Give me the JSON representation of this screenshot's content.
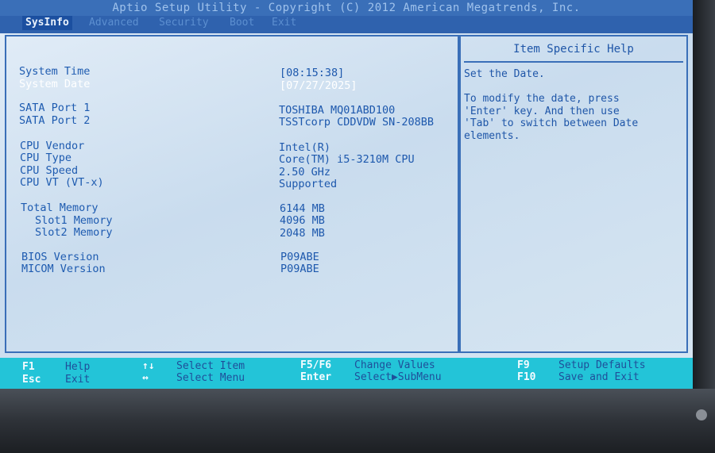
{
  "title": "Aptio Setup Utility - Copyright (C) 2012 American Megatrends, Inc.",
  "tabs": [
    {
      "label": "SysInfo",
      "active": true
    },
    {
      "label": "Advanced",
      "active": false
    },
    {
      "label": "Security",
      "active": false
    },
    {
      "label": "Boot",
      "active": false
    },
    {
      "label": "Exit",
      "active": false
    }
  ],
  "info": {
    "system_time": {
      "label": "System Time",
      "value": "[08:15:38]"
    },
    "system_date": {
      "label": "System Date",
      "value": "[07/27/2025]"
    },
    "sata1": {
      "label": "SATA Port 1",
      "value": "TOSHIBA MQ01ABD100"
    },
    "sata2": {
      "label": "SATA Port 2",
      "value": "TSSTcorp CDDVDW SN-208BB"
    },
    "cpu_vendor": {
      "label": "CPU Vendor",
      "value": "Intel(R)"
    },
    "cpu_type": {
      "label": "CPU Type",
      "value": "Core(TM) i5-3210M CPU"
    },
    "cpu_speed": {
      "label": "CPU Speed",
      "value": "2.50 GHz"
    },
    "cpu_vt": {
      "label": "CPU VT (VT-x)",
      "value": "Supported"
    },
    "total_memory": {
      "label": "Total Memory",
      "value": "6144 MB"
    },
    "slot1": {
      "label": "Slot1 Memory",
      "value": "4096 MB"
    },
    "slot2": {
      "label": "Slot2 Memory",
      "value": "2048 MB"
    },
    "bios_version": {
      "label": "BIOS Version",
      "value": "P09ABE"
    },
    "micom_version": {
      "label": "MICOM Version",
      "value": "P09ABE"
    }
  },
  "help": {
    "title": "Item Specific Help",
    "line1": "Set the Date.",
    "line2": "To modify the date, press\n'Enter' key. And then use\n'Tab' to switch between Date\nelements."
  },
  "footer": {
    "f1_key": "F1",
    "f1_desc": "Help",
    "esc_key": "Esc",
    "esc_desc": "Exit",
    "updown_key": "↑↓",
    "updown_desc": "Select Item",
    "leftright_key": "↔",
    "leftright_desc": "Select Menu",
    "f5f6_key": "F5/F6",
    "f5f6_desc": "Change Values",
    "enter_key": "Enter",
    "enter_desc": "Select▶SubMenu",
    "f9_key": "F9",
    "f9_desc": "Setup Defaults",
    "f10_key": "F10",
    "f10_desc": "Save and Exit"
  }
}
